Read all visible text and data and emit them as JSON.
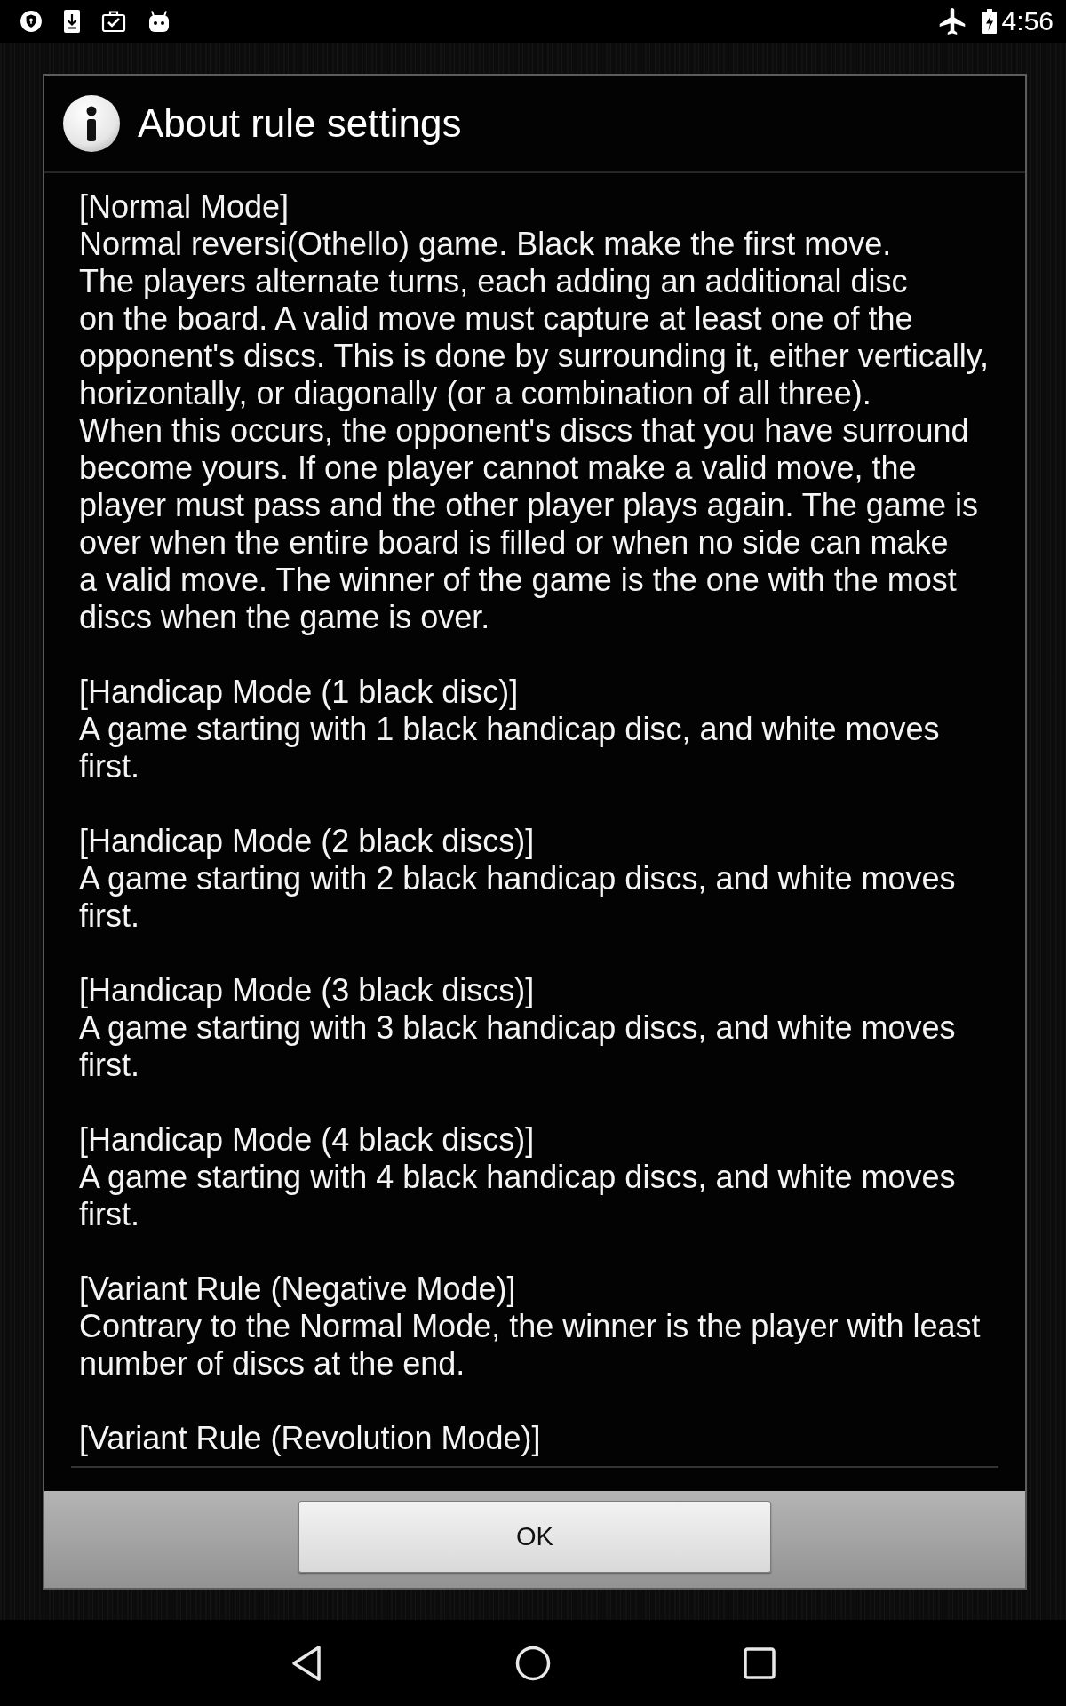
{
  "status_bar": {
    "time": "4:56"
  },
  "dialog": {
    "title": "About rule settings",
    "sections": [
      {
        "heading": "[Normal Mode]",
        "body": "Normal reversi(Othello) game. Black make the first move.\nThe players alternate turns, each adding an additional disc\non the board. A valid move must capture at least one of the\nopponent's discs. This is done by surrounding it, either vertically,\nhorizontally, or diagonally (or a combination of all three).\nWhen this occurs, the opponent's discs that you have surround\nbecome yours. If one player cannot make a valid move, the\nplayer must pass and the other player plays again. The game is\nover when the entire board is filled or when no side can make\na valid move. The winner of the game is the one with the most\ndiscs when the game is over."
      },
      {
        "heading": "[Handicap Mode (1 black disc)]",
        "body": "A game starting with 1 black handicap disc, and white moves\nfirst."
      },
      {
        "heading": "[Handicap Mode (2 black discs)]",
        "body": "A game starting with 2 black handicap discs, and white moves\nfirst."
      },
      {
        "heading": "[Handicap Mode (3 black discs)]",
        "body": "A game starting with 3 black handicap discs, and white moves\nfirst."
      },
      {
        "heading": "[Handicap Mode (4 black discs)]",
        "body": "A game starting with 4 black handicap discs, and white moves\nfirst."
      },
      {
        "heading": "[Variant Rule (Negative Mode)]",
        "body": "Contrary to the Normal Mode, the winner is the player with least\nnumber of discs at the end."
      },
      {
        "heading": "[Variant Rule (Revolution Mode)]"
      }
    ],
    "buttons": [
      {
        "label": "OK"
      }
    ]
  }
}
